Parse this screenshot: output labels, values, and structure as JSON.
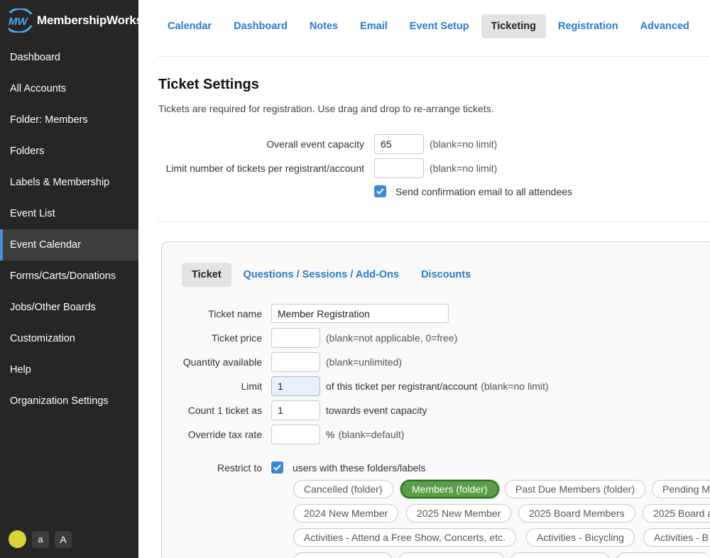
{
  "app": {
    "brand": "MembershipWorks"
  },
  "sidebar": {
    "items": [
      {
        "label": "Dashboard"
      },
      {
        "label": "All Accounts"
      },
      {
        "label": "Folder: Members"
      },
      {
        "label": "Folders"
      },
      {
        "label": "Labels & Membership"
      },
      {
        "label": "Event List"
      },
      {
        "label": "Event Calendar",
        "active": true
      },
      {
        "label": "Forms/Carts/Donations"
      },
      {
        "label": "Jobs/Other Boards"
      },
      {
        "label": "Customization"
      },
      {
        "label": "Help"
      },
      {
        "label": "Organization Settings"
      }
    ],
    "font_small": "a",
    "font_large": "A"
  },
  "tabs": [
    {
      "label": "Calendar"
    },
    {
      "label": "Dashboard"
    },
    {
      "label": "Notes"
    },
    {
      "label": "Email"
    },
    {
      "label": "Event Setup"
    },
    {
      "label": "Ticketing",
      "active": true
    },
    {
      "label": "Registration"
    },
    {
      "label": "Advanced"
    }
  ],
  "ticket_settings": {
    "title": "Ticket Settings",
    "description": "Tickets are required for registration. Use drag and drop to re-arrange tickets.",
    "capacity_label": "Overall event capacity",
    "capacity_value": "65",
    "capacity_hint": "(blank=no limit)",
    "limit_label": "Limit number of tickets per registrant/account",
    "limit_value": "",
    "limit_hint": "(blank=no limit)",
    "confirm_label": "Send confirmation email to all attendees",
    "confirm_checked": true
  },
  "panel": {
    "subtabs": [
      {
        "label": "Ticket",
        "active": true
      },
      {
        "label": "Questions / Sessions / Add-Ons"
      },
      {
        "label": "Discounts"
      }
    ],
    "fields": {
      "name_label": "Ticket name",
      "name_value": "Member Registration",
      "price_label": "Ticket price",
      "price_value": "",
      "price_hint": "(blank=not applicable, 0=free)",
      "qty_label": "Quantity available",
      "qty_value": "",
      "qty_hint": "(blank=unlimited)",
      "limit_label": "Limit",
      "limit_value": "1",
      "limit_text": "of this ticket per registrant/account",
      "limit_hint": "(blank=no limit)",
      "count_label": "Count 1 ticket as",
      "count_value": "1",
      "count_text": "towards event capacity",
      "tax_label": "Override tax rate",
      "tax_value": "",
      "tax_text": "%",
      "tax_hint": "(blank=default)",
      "restrict_label": "Restrict to",
      "restrict_checked": true,
      "restrict_text": "users with these folders/labels"
    },
    "pills_row1": [
      "Cancelled (folder)",
      "Members (folder)",
      "Past Due Members (folder)",
      "Pending M"
    ],
    "pills_row2": [
      "2024 New Member",
      "2025 New Member",
      "2025 Board Members",
      "2025 Board a"
    ],
    "pills_row3": [
      "Activities - Attend a Free Show, Concerts, etc.",
      "Activities - Bicycling",
      "Activities - B"
    ],
    "selected_pill": "Members (folder)"
  },
  "colors": {
    "sidebar_bg": "#262626",
    "link": "#2a7bc4",
    "accent": "#3b88d6",
    "selected_pill": "#5a9e48"
  }
}
